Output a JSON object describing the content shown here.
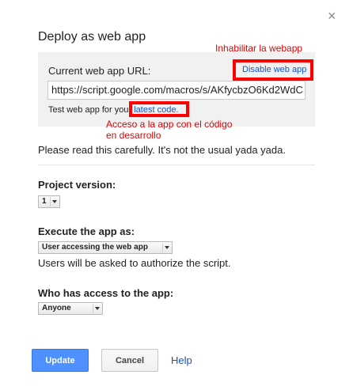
{
  "dialog": {
    "title": "Deploy as web app",
    "close_glyph": "×"
  },
  "web_app": {
    "url_label": "Current web app URL:",
    "url_value": "https://script.google.com/macros/s/AKfycbzO6Kd2WdC",
    "disable_link": "Disable web app",
    "test_prefix": "Test web app for your ",
    "test_link": "latest code."
  },
  "annotations": {
    "disable_note": "Inhabilitar la webapp",
    "latest_note": "Acceso a la app con el código en desarrollo"
  },
  "notice": "Please read this carefully. It's not the usual yada yada.",
  "project_version": {
    "label": "Project version:",
    "value": "1"
  },
  "execute_as": {
    "label": "Execute the app as:",
    "value": "User accessing the web app",
    "help_text": "Users will be asked to authorize the script."
  },
  "access": {
    "label": "Who has access to the app:",
    "value": "Anyone"
  },
  "buttons": {
    "update": "Update",
    "cancel": "Cancel",
    "help": "Help"
  },
  "colors": {
    "primary_button": "#4d90fe",
    "link": "#1155cc",
    "annotation": "#ff0000"
  }
}
